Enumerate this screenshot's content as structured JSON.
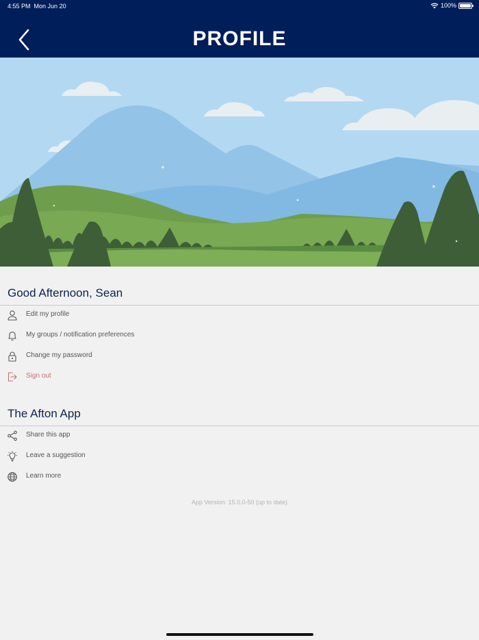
{
  "status_bar": {
    "time": "4:55 PM",
    "date": "Mon Jun 20",
    "battery": "100%",
    "battery_level": 1.0
  },
  "header": {
    "title": "PROFILE",
    "back_icon": "chevron-left-icon"
  },
  "greeting_section": {
    "title": "Good Afternoon, Sean",
    "items": [
      {
        "label": "Edit my profile",
        "icon": "user-icon"
      },
      {
        "label": "My groups / notification preferences",
        "icon": "bell-icon"
      },
      {
        "label": "Change my password",
        "icon": "lock-icon"
      },
      {
        "label": "Sign out",
        "icon": "sign-out-icon"
      }
    ]
  },
  "app_section": {
    "title": "The Afton App",
    "items": [
      {
        "label": "Share this app",
        "icon": "share-icon"
      },
      {
        "label": "Leave a suggestion",
        "icon": "lightbulb-icon"
      },
      {
        "label": "Learn more",
        "icon": "globe-icon"
      }
    ]
  },
  "app_version": "App Version: 15.0.0-50 (up to date)",
  "colors": {
    "header_bg": "#001e5a",
    "danger": "#c1706e",
    "section_title": "#0e2350"
  }
}
